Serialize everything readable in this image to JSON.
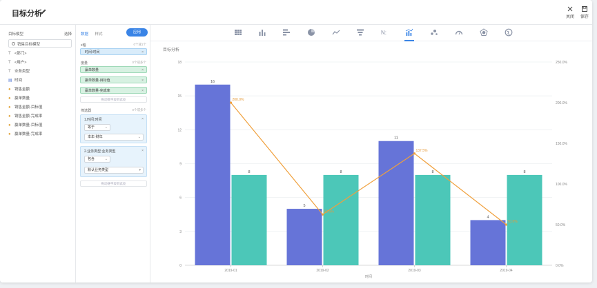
{
  "header": {
    "title": "目标分析",
    "close_label": "关闭",
    "save_label": "保存"
  },
  "left_panel": {
    "title": "目标模型",
    "select_label": "选择",
    "model_name": "销售目标模型",
    "fields": [
      {
        "icon": "T",
        "type": "t",
        "label": "<部门>"
      },
      {
        "icon": "T",
        "type": "t",
        "label": "<用户>"
      },
      {
        "icon": "T",
        "type": "t",
        "label": "业务类型"
      },
      {
        "icon": "▤",
        "type": "d",
        "label": "时间"
      },
      {
        "icon": "●",
        "type": "n",
        "label": "销售金额"
      },
      {
        "icon": "●",
        "type": "n",
        "label": "赢单数量"
      },
      {
        "icon": "●",
        "type": "n",
        "label": "销售金额-目标值"
      },
      {
        "icon": "●",
        "type": "n",
        "label": "销售金额-完成率"
      },
      {
        "icon": "●",
        "type": "n",
        "label": "赢单数量-目标值"
      },
      {
        "icon": "●",
        "type": "n",
        "label": "赢单数量-完成率"
      }
    ]
  },
  "config_panel": {
    "tabs": [
      "数据",
      "样式"
    ],
    "apply_label": "应用",
    "x_axis": {
      "label": "x轴",
      "hint": "0个或1个",
      "items": [
        "时间:时间"
      ]
    },
    "measures": {
      "label": "度量",
      "hint": "0个或多个",
      "items": [
        "赢单数量",
        "赢单数量-目标值",
        "赢单数量-完成率"
      ]
    },
    "add_field_label": "拖动数字段到此处",
    "filters": {
      "label": "筛选器",
      "hint": "0个或多个",
      "cards": [
        {
          "title": "1.时间:时间",
          "op": "等于",
          "value": "本年-财年"
        },
        {
          "title": "2.业务类型:业务类型",
          "op": "包含",
          "value": "默认业务类型"
        }
      ],
      "add_label": "拖动维字段到此处"
    }
  },
  "chart_toolbar": {
    "icons": [
      "table-icon",
      "bar-chart-icon",
      "horizontal-bar-icon",
      "pie-chart-icon",
      "line-chart-icon",
      "funnel-icon",
      "number-card-icon",
      "combo-chart-icon",
      "scatter-icon",
      "gauge-icon",
      "radar-icon",
      "map-icon"
    ],
    "active": "combo-chart-icon"
  },
  "chart_data": {
    "type": "bar",
    "title": "目标分析",
    "xlabel": "时间",
    "categories": [
      "2019-01",
      "2019-02",
      "2019-03",
      "2019-04"
    ],
    "series": [
      {
        "name": "赢单数量",
        "type": "bar",
        "axis": "left",
        "color": "#6674d8",
        "values": [
          16,
          5,
          11,
          4
        ]
      },
      {
        "name": "赢单数量-目标值",
        "type": "bar",
        "axis": "left",
        "color": "#4cc7b8",
        "values": [
          8,
          8,
          8,
          8
        ]
      },
      {
        "name": "赢单数量-完成率",
        "type": "line",
        "axis": "right",
        "color": "#f0a03c",
        "values": [
          200,
          62.5,
          137.5,
          50
        ],
        "labels": [
          "200.0%",
          "62.5%",
          "137.5%",
          "50.0%"
        ]
      }
    ],
    "y_left": {
      "range": [
        0,
        18
      ],
      "ticks": [
        "0",
        "3",
        "6",
        "9",
        "12",
        "15",
        "18"
      ]
    },
    "y_right": {
      "range": [
        0,
        250
      ],
      "ticks": [
        "0.0%",
        "50.0%",
        "100.0%",
        "150.0%",
        "200.0%",
        "250.0%"
      ]
    },
    "grid": true
  }
}
